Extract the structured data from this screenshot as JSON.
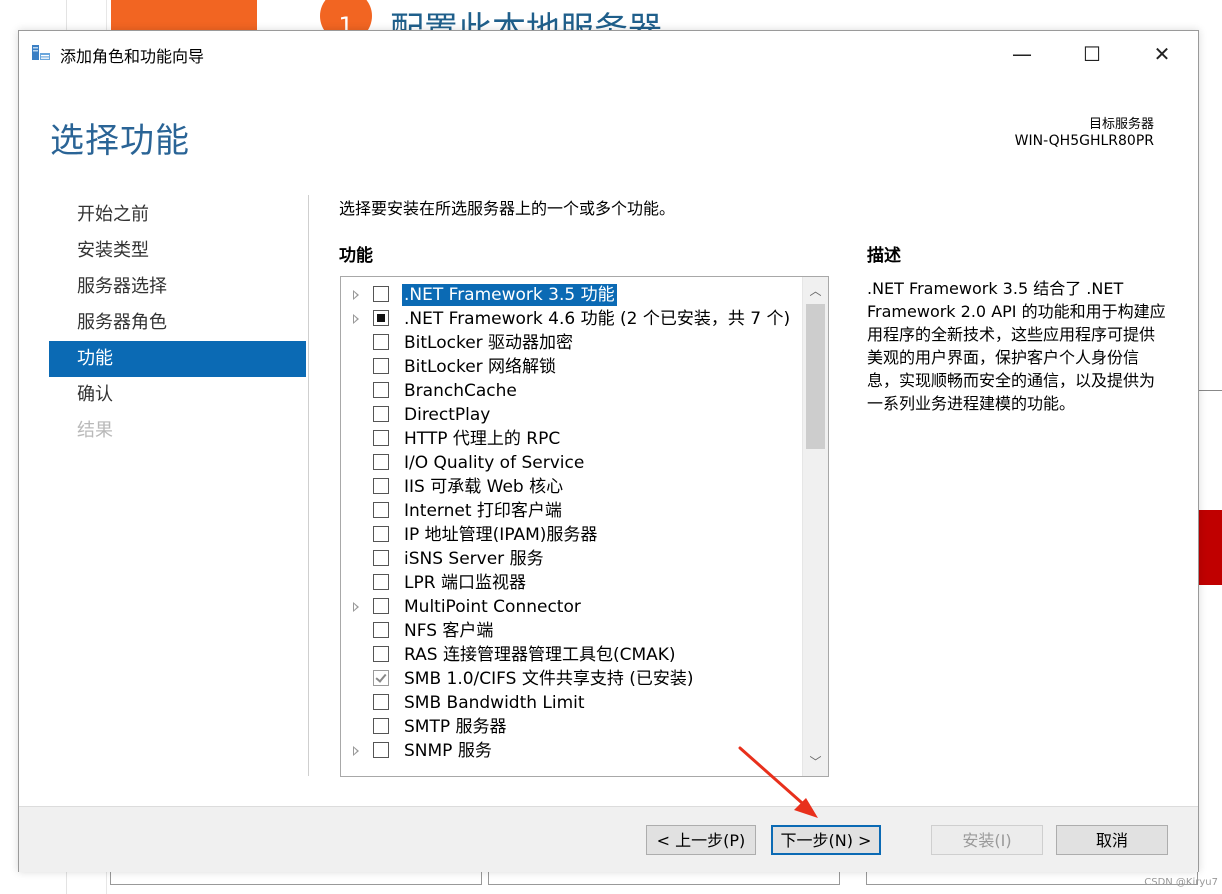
{
  "background": {
    "step_number": "1",
    "heading": "配置此本地服务器",
    "watermark": "CSDN @Kiryu7"
  },
  "window": {
    "title": "添加角色和功能向导",
    "minimize": "—",
    "maximize": "☐",
    "close": "✕"
  },
  "page": {
    "title": "选择功能",
    "target_server_label": "目标服务器",
    "target_server_value": "WIN-QH5GHLR80PR"
  },
  "nav": {
    "items": [
      {
        "label": "开始之前",
        "state": "normal"
      },
      {
        "label": "安装类型",
        "state": "normal"
      },
      {
        "label": "服务器选择",
        "state": "normal"
      },
      {
        "label": "服务器角色",
        "state": "normal"
      },
      {
        "label": "功能",
        "state": "active"
      },
      {
        "label": "确认",
        "state": "normal"
      },
      {
        "label": "结果",
        "state": "disabled"
      }
    ]
  },
  "main": {
    "instruction": "选择要安装在所选服务器上的一个或多个功能。",
    "features_header": "功能",
    "description_header": "描述",
    "description_text": ".NET Framework 3.5 结合了 .NET Framework 2.0 API 的功能和用于构建应用程序的全新技术，这些应用程序可提供美观的用户界面，保护客户个人身份信息，实现顺畅而安全的通信，以及提供为一系列业务进程建模的功能。",
    "features": [
      {
        "label": ".NET Framework 3.5 功能",
        "expandable": true,
        "state": "unchecked",
        "selected": true
      },
      {
        "label": ".NET Framework 4.6 功能 (2 个已安装，共 7 个)",
        "expandable": true,
        "state": "partial",
        "selected": false
      },
      {
        "label": "BitLocker 驱动器加密",
        "expandable": false,
        "state": "unchecked",
        "selected": false
      },
      {
        "label": "BitLocker 网络解锁",
        "expandable": false,
        "state": "unchecked",
        "selected": false
      },
      {
        "label": "BranchCache",
        "expandable": false,
        "state": "unchecked",
        "selected": false
      },
      {
        "label": "DirectPlay",
        "expandable": false,
        "state": "unchecked",
        "selected": false
      },
      {
        "label": "HTTP 代理上的 RPC",
        "expandable": false,
        "state": "unchecked",
        "selected": false
      },
      {
        "label": "I/O Quality of Service",
        "expandable": false,
        "state": "unchecked",
        "selected": false
      },
      {
        "label": "IIS 可承载 Web 核心",
        "expandable": false,
        "state": "unchecked",
        "selected": false
      },
      {
        "label": "Internet 打印客户端",
        "expandable": false,
        "state": "unchecked",
        "selected": false
      },
      {
        "label": "IP 地址管理(IPAM)服务器",
        "expandable": false,
        "state": "unchecked",
        "selected": false
      },
      {
        "label": "iSNS Server 服务",
        "expandable": false,
        "state": "unchecked",
        "selected": false
      },
      {
        "label": "LPR 端口监视器",
        "expandable": false,
        "state": "unchecked",
        "selected": false
      },
      {
        "label": "MultiPoint Connector",
        "expandable": true,
        "state": "unchecked",
        "selected": false
      },
      {
        "label": "NFS 客户端",
        "expandable": false,
        "state": "unchecked",
        "selected": false
      },
      {
        "label": "RAS 连接管理器管理工具包(CMAK)",
        "expandable": false,
        "state": "unchecked",
        "selected": false
      },
      {
        "label": "SMB 1.0/CIFS 文件共享支持 (已安装)",
        "expandable": false,
        "state": "checked",
        "selected": false
      },
      {
        "label": "SMB Bandwidth Limit",
        "expandable": false,
        "state": "unchecked",
        "selected": false
      },
      {
        "label": "SMTP 服务器",
        "expandable": false,
        "state": "unchecked",
        "selected": false
      },
      {
        "label": "SNMP 服务",
        "expandable": true,
        "state": "unchecked",
        "selected": false
      }
    ]
  },
  "footer": {
    "prev": "< 上一步(P)",
    "next": "下一步(N) >",
    "install": "安装(I)",
    "cancel": "取消"
  },
  "colors": {
    "accent": "#0b6ab4",
    "title": "#2a6496",
    "annotation_arrow": "#e8301c",
    "background_orange": "#f26522"
  }
}
